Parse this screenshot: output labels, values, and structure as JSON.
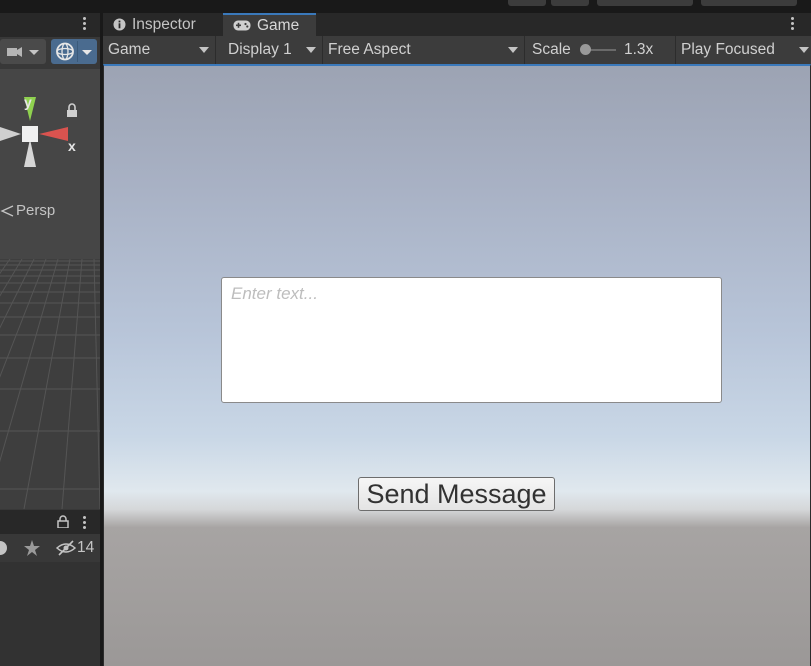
{
  "scene_panel": {
    "axis_y": "y",
    "axis_x": "x",
    "projection_label": "Persp"
  },
  "hierarchy_panel": {
    "hidden_count": "14"
  },
  "tabs": {
    "inspector": "Inspector",
    "game": "Game"
  },
  "game_toolbar": {
    "view_mode": "Game",
    "display": "Display 1",
    "aspect": "Free Aspect",
    "scale_label": "Scale",
    "scale_value": "1.3x",
    "play_mode": "Play Focused"
  },
  "game_view": {
    "input_placeholder": "Enter text...",
    "input_value": "",
    "send_button_label": "Send Message"
  },
  "colors": {
    "accent": "#3a79bb",
    "gizmo_x": "#d9534f",
    "gizmo_y": "#8fd14f",
    "gizmo_z": "#e0e0e0"
  }
}
